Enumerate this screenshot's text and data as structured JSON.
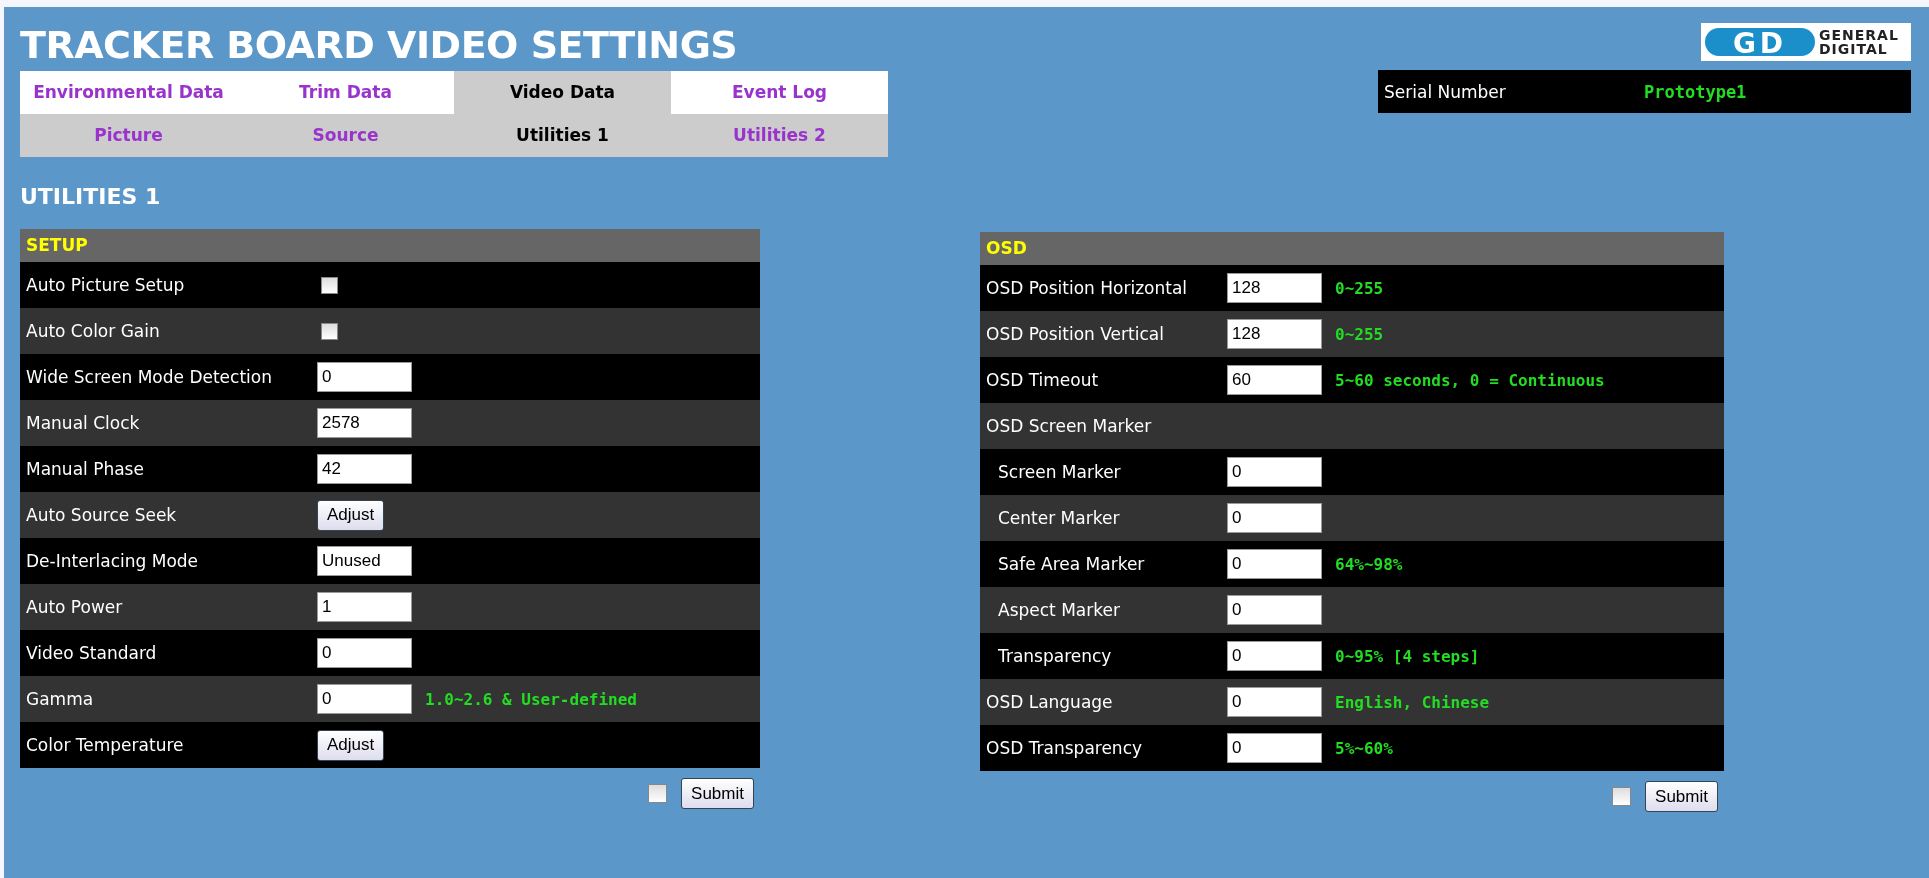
{
  "title": "TRACKER BOARD VIDEO SETTINGS",
  "logo": {
    "mark": "GD",
    "lines": [
      "GENERAL",
      "DIGITAL"
    ]
  },
  "serial": {
    "label": "Serial Number",
    "value": "Prototype1"
  },
  "tabs": [
    {
      "label": "Environmental Data",
      "selected": false
    },
    {
      "label": "Trim Data",
      "selected": false
    },
    {
      "label": "Video Data",
      "selected": true
    },
    {
      "label": "Event Log",
      "selected": false
    }
  ],
  "subtabs": [
    {
      "label": "Picture",
      "selected": false
    },
    {
      "label": "Source",
      "selected": false
    },
    {
      "label": "Utilities 1",
      "selected": true
    },
    {
      "label": "Utilities 2",
      "selected": false
    }
  ],
  "page_heading": "UTILITIES 1",
  "panels": [
    {
      "title": "SETUP",
      "rows": [
        {
          "kind": "checkbox",
          "label": "Auto Picture Setup",
          "checked": false
        },
        {
          "kind": "checkbox",
          "label": "Auto Color Gain",
          "checked": false
        },
        {
          "kind": "input",
          "label": "Wide Screen Mode Detection",
          "value": "0"
        },
        {
          "kind": "input",
          "label": "Manual Clock",
          "value": "2578"
        },
        {
          "kind": "input",
          "label": "Manual Phase",
          "value": "42"
        },
        {
          "kind": "button",
          "label": "Auto Source Seek",
          "button": "Adjust"
        },
        {
          "kind": "input",
          "label": "De-Interlacing Mode",
          "value": "Unused"
        },
        {
          "kind": "input",
          "label": "Auto Power",
          "value": "1"
        },
        {
          "kind": "input",
          "label": "Video Standard",
          "value": "0"
        },
        {
          "kind": "input",
          "label": "Gamma",
          "value": "0",
          "hint": "1.0~2.6 & User-defined"
        },
        {
          "kind": "button",
          "label": "Color Temperature",
          "button": "Adjust"
        }
      ],
      "submit": {
        "checked": false,
        "label": "Submit"
      }
    },
    {
      "title": "OSD",
      "rows": [
        {
          "kind": "input",
          "label": "OSD Position Horizontal",
          "value": "128",
          "hint": "0~255"
        },
        {
          "kind": "input",
          "label": "OSD Position Vertical",
          "value": "128",
          "hint": "0~255"
        },
        {
          "kind": "input",
          "label": "OSD Timeout",
          "value": "60",
          "hint": "5~60 seconds, 0 = Continuous"
        },
        {
          "kind": "group",
          "label": "OSD Screen Marker",
          "children": [
            {
              "kind": "input",
              "label": "Screen Marker",
              "value": "0"
            },
            {
              "kind": "input",
              "label": "Center Marker",
              "value": "0"
            },
            {
              "kind": "input",
              "label": "Safe Area Marker",
              "value": "0",
              "hint": "64%~98%"
            },
            {
              "kind": "input",
              "label": "Aspect Marker",
              "value": "0"
            },
            {
              "kind": "input",
              "label": "Transparency",
              "value": "0",
              "hint": "0~95% [4 steps]"
            }
          ]
        },
        {
          "kind": "input",
          "label": "OSD Language",
          "value": "0",
          "hint": "English, Chinese"
        },
        {
          "kind": "input",
          "label": "OSD Transparency",
          "value": "0",
          "hint": "5%~60%"
        }
      ],
      "submit": {
        "checked": false,
        "label": "Submit"
      }
    }
  ]
}
